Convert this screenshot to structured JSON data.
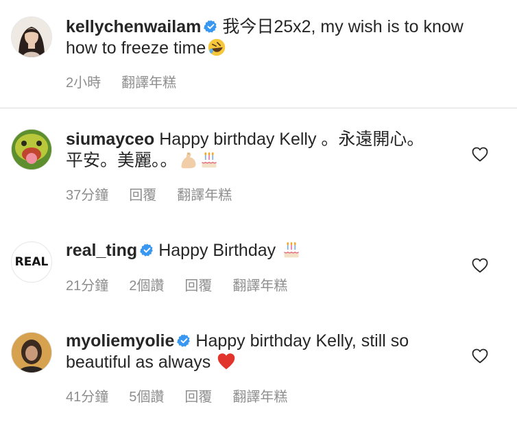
{
  "caption": {
    "username": "kellychenwailam",
    "text": "我今日25x2, my wish is to know how to freeze time",
    "emoji": "rolling-laughing-emoji",
    "time": "2小時",
    "translate": "翻譯年糕"
  },
  "comments": [
    {
      "username": "siumayceo",
      "text": "Happy birthday Kelly 。永遠開心。平安。美麗。。",
      "emoji": [
        "flexed-biceps-emoji",
        "birthday-cake-emoji"
      ],
      "time": "37分鐘",
      "reply": "回覆",
      "translate": "翻譯年糕"
    },
    {
      "username": "real_ting",
      "avatar_text": "REAL",
      "text": "Happy Birthday",
      "emoji": [
        "birthday-cake-emoji"
      ],
      "time": "21分鐘",
      "likes": "2個讚",
      "reply": "回覆",
      "translate": "翻譯年糕"
    },
    {
      "username": "myoliemyolie",
      "text": "Happy birthday Kelly, still so beautiful as always",
      "emoji": [
        "red-heart-emoji"
      ],
      "time": "41分鐘",
      "likes": "5個讚",
      "reply": "回覆",
      "translate": "翻譯年糕"
    }
  ],
  "colors": {
    "text": "#262626",
    "secondary": "#8e8e8e",
    "verified": "#3897f0",
    "divider": "#dbdbdb"
  }
}
